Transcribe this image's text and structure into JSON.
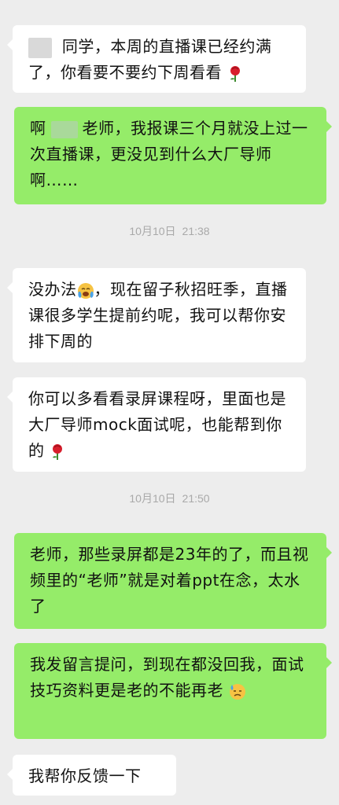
{
  "messages": [
    {
      "text": "同学，本周的直播课已经约满了，你看要不要约下周看看",
      "emoji": "rose-icon"
    },
    {
      "prefix": "啊",
      "text": "老师，我报课三个月就没上过一次直播课，更没见到什么大厂导师啊……"
    },
    {
      "prefix": "没办法",
      "text": "，现在留子秋招旺季，直播课很多学生提前约呢，我可以帮你安排下周的",
      "emoji": "crying-face-icon"
    },
    {
      "text": "你可以多看看录屏课程呀，里面也是大厂导师mock面试呢，也能帮到你的",
      "emoji": "rose-icon"
    },
    {
      "text": "老师，那些录屏都是23年的了，而且视频里的“老师”就是对着ppt在念，太水了"
    },
    {
      "text": "我发留言提问，到现在都没回我，面试技巧资料更是老的不能再老",
      "emoji": "sweat-face-icon"
    },
    {
      "text": "我帮你反馈一下"
    }
  ],
  "timestamps": [
    {
      "date": "10月10日",
      "time": "21:38"
    },
    {
      "date": "10月10日",
      "time": "21:50"
    }
  ]
}
